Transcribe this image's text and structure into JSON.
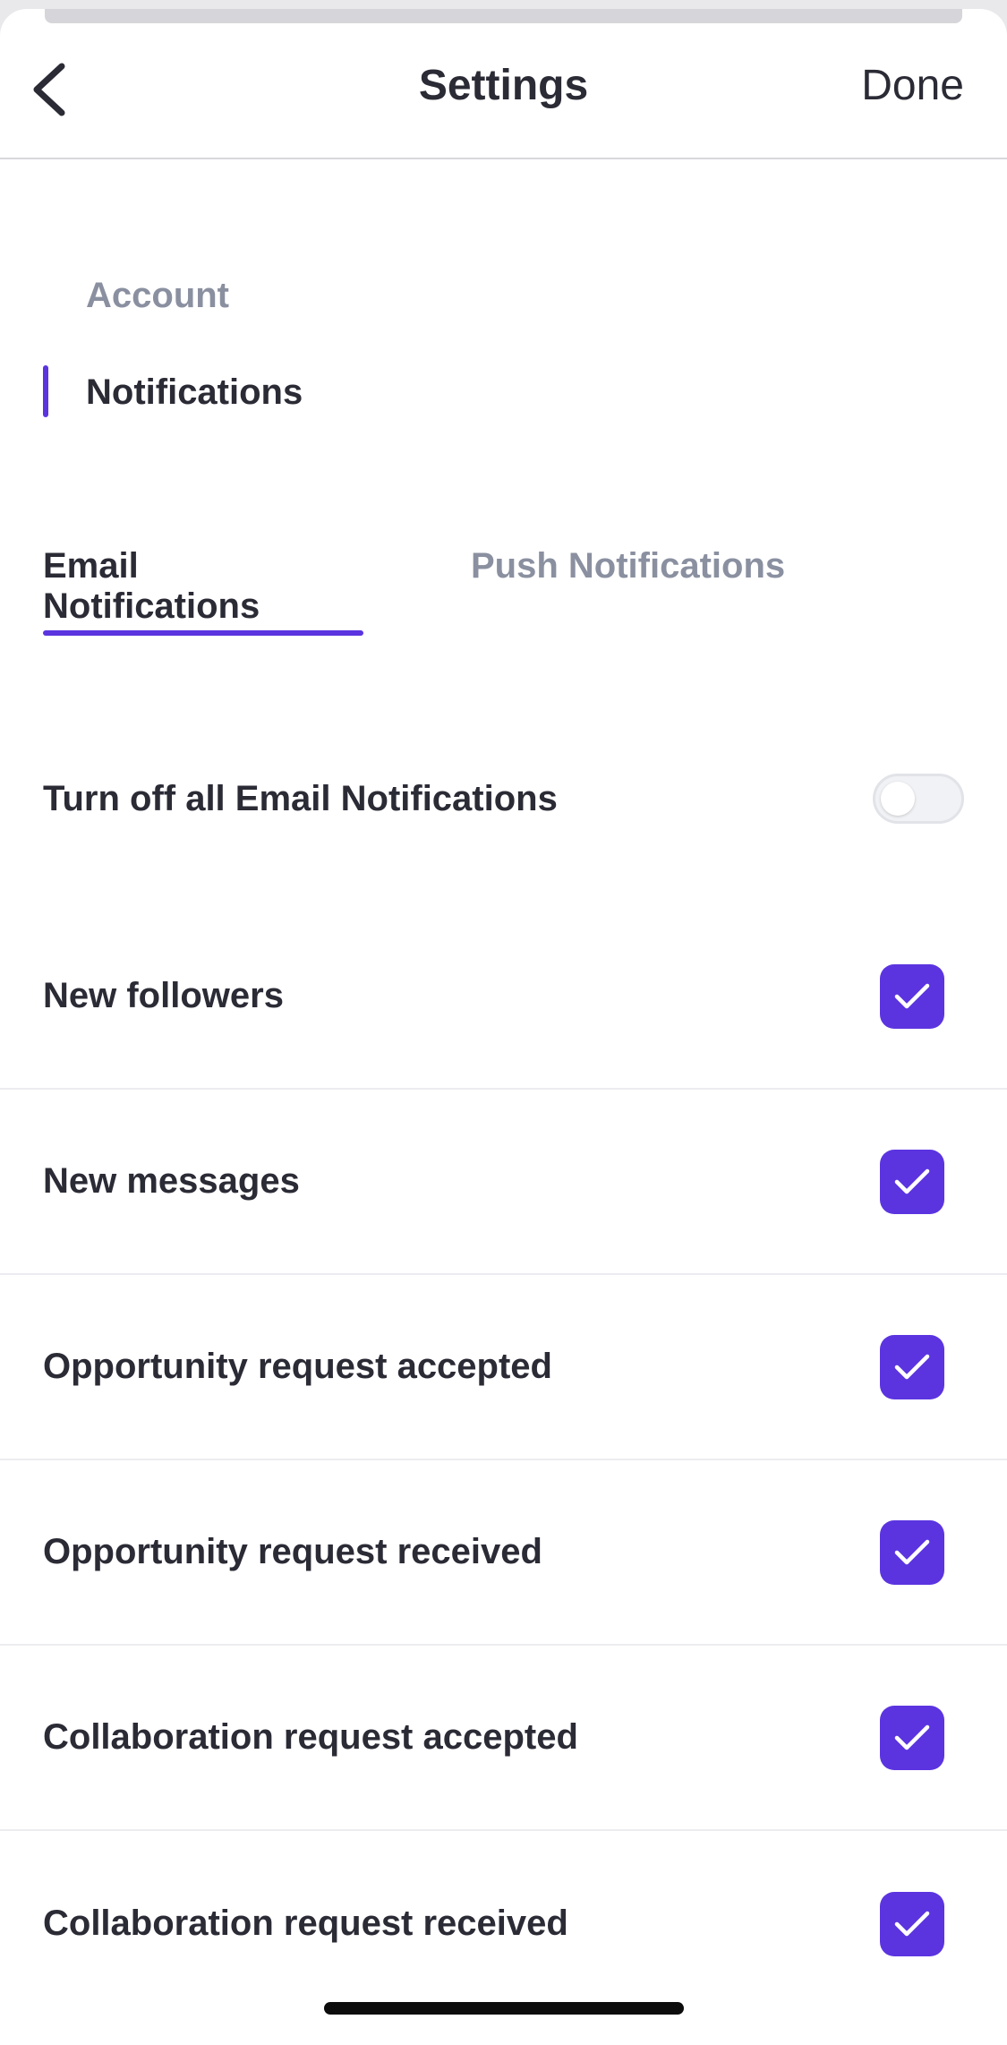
{
  "header": {
    "title": "Settings",
    "done_label": "Done",
    "back_icon": "chevron-left-icon"
  },
  "nav": {
    "items": [
      {
        "label": "Account",
        "active": false
      },
      {
        "label": "Notifications",
        "active": true
      }
    ]
  },
  "tabs": [
    {
      "label": "Email Notifications",
      "active": true
    },
    {
      "label": "Push Notifications",
      "active": false
    }
  ],
  "master_toggle": {
    "label": "Turn off all Email Notifications",
    "on": false
  },
  "options": [
    {
      "label": "New followers",
      "checked": true
    },
    {
      "label": "New messages",
      "checked": true
    },
    {
      "label": "Opportunity request accepted",
      "checked": true
    },
    {
      "label": "Opportunity request received",
      "checked": true
    },
    {
      "label": "Collaboration request accepted",
      "checked": true
    },
    {
      "label": "Collaboration request received",
      "checked": true
    }
  ],
  "colors": {
    "accent": "#5b34e0",
    "text": "#2b2b36",
    "muted": "#8a90a0"
  }
}
